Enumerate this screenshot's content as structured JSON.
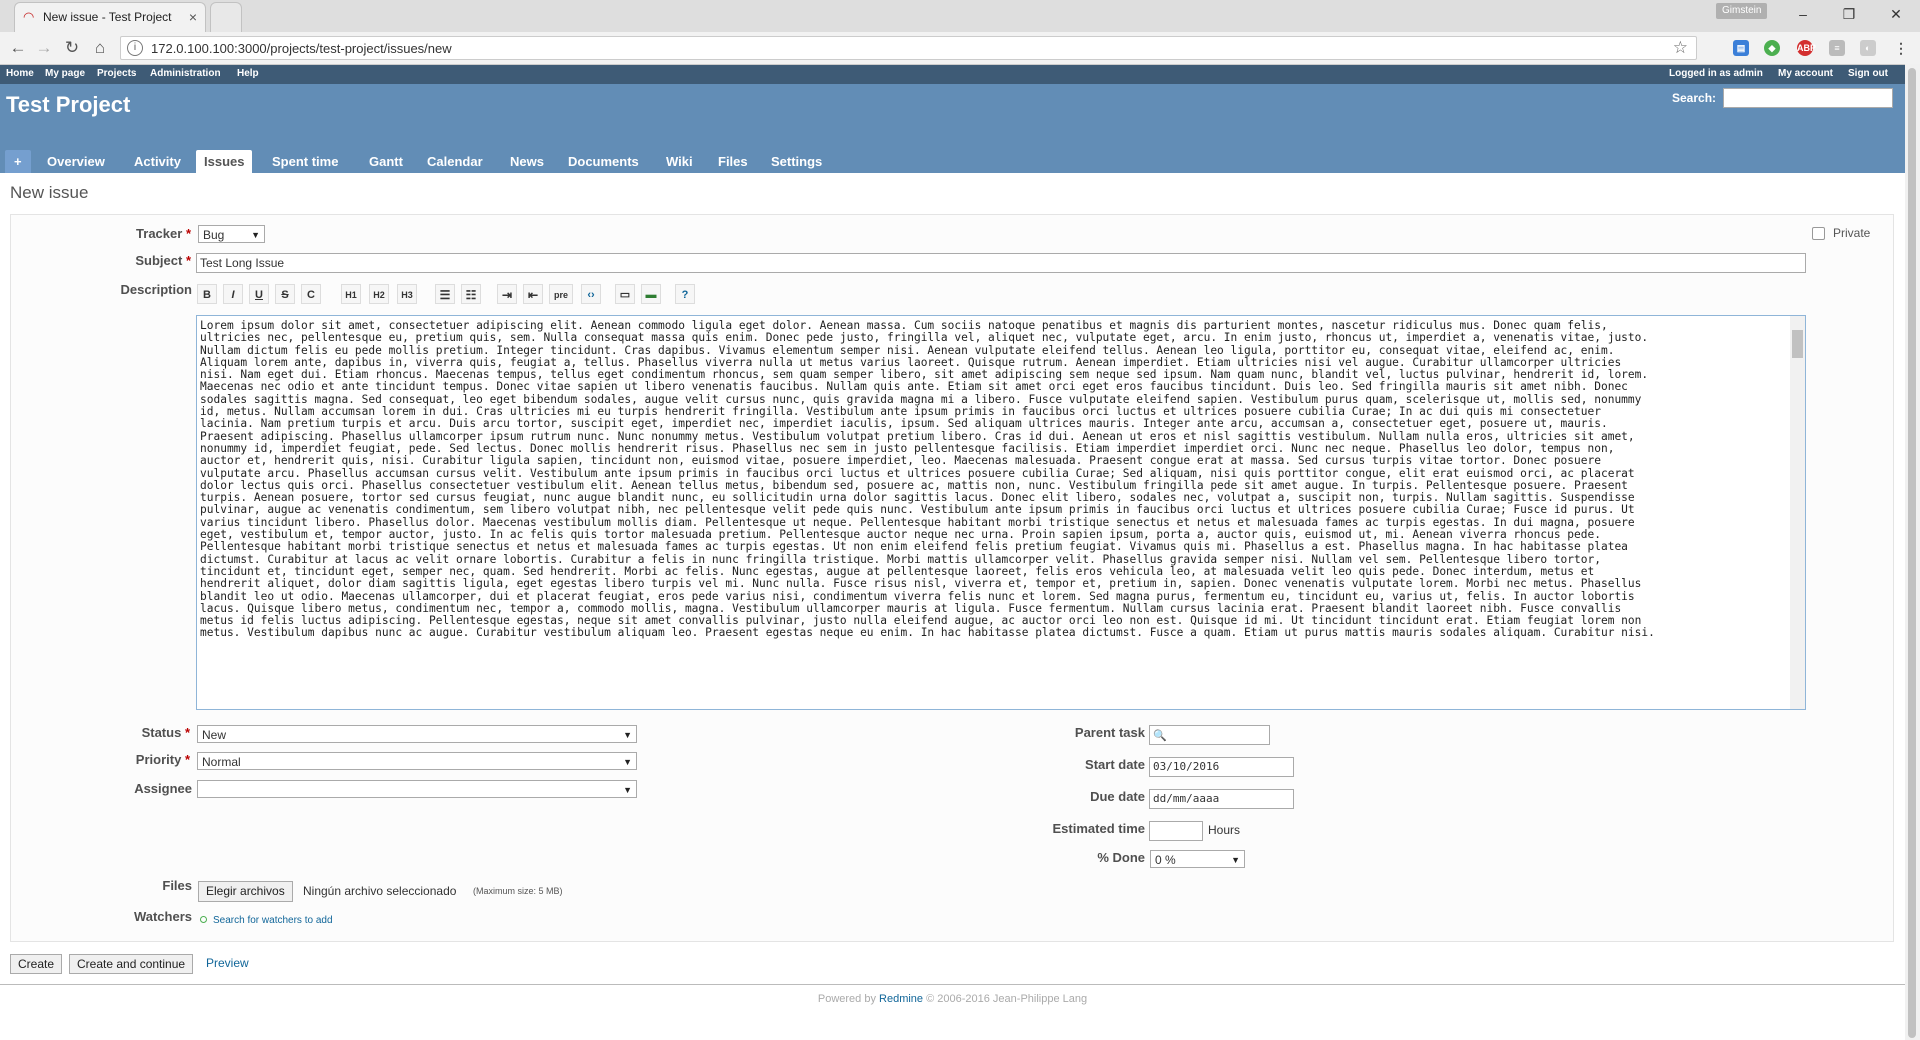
{
  "browser": {
    "tab_title": "New issue - Test Project",
    "user_chip": "Gimstein",
    "url": "172.0.100.100:3000/projects/test-project/issues/new"
  },
  "top_menu": {
    "left": [
      "Home",
      "My page",
      "Projects",
      "Administration",
      "Help"
    ],
    "logged_in_prefix": "Logged in as",
    "logged_in_user": "admin",
    "right": [
      "My account",
      "Sign out"
    ]
  },
  "header": {
    "project_title": "Test Project",
    "search_label": "Search:"
  },
  "main_menu": {
    "plus": "+",
    "tabs": [
      "Overview",
      "Activity",
      "Issues",
      "Spent time",
      "Gantt",
      "Calendar",
      "News",
      "Documents",
      "Wiki",
      "Files",
      "Settings"
    ],
    "selected": "Issues"
  },
  "page_title": "New issue",
  "form": {
    "tracker_label": "Tracker",
    "tracker_value": "Bug",
    "private_label": "Private",
    "subject_label": "Subject",
    "subject_value": "Test Long Issue",
    "description_label": "Description",
    "toolbar": [
      "B",
      "I",
      "U",
      "S",
      "C",
      "H1",
      "H2",
      "H3",
      "ul",
      "ol",
      "indent",
      "outdent",
      "pre",
      "code",
      "link",
      "image",
      "help"
    ],
    "description_lines": [
      "Lorem ipsum dolor sit amet, consectetuer adipiscing elit. Aenean commodo ligula eget dolor. Aenean massa. Cum sociis natoque penatibus et magnis dis parturient montes, nascetur ridiculus mus. Donec quam felis,",
      "ultricies nec, pellentesque eu, pretium quis, sem. Nulla consequat massa quis enim. Donec pede justo, fringilla vel, aliquet nec, vulputate eget, arcu. In enim justo, rhoncus ut, imperdiet a, venenatis vitae, justo.",
      "Nullam dictum felis eu pede mollis pretium. Integer tincidunt. Cras dapibus. Vivamus elementum semper nisi. Aenean vulputate eleifend tellus. Aenean leo ligula, porttitor eu, consequat vitae, eleifend ac, enim.",
      "Aliquam lorem ante, dapibus in, viverra quis, feugiat a, tellus. Phasellus viverra nulla ut metus varius laoreet. Quisque rutrum. Aenean imperdiet. Etiam ultricies nisi vel augue. Curabitur ullamcorper ultricies",
      "nisi. Nam eget dui. Etiam rhoncus. Maecenas tempus, tellus eget condimentum rhoncus, sem quam semper libero, sit amet adipiscing sem neque sed ipsum. Nam quam nunc, blandit vel, luctus pulvinar, hendrerit id, lorem.",
      "Maecenas nec odio et ante tincidunt tempus. Donec vitae sapien ut libero venenatis faucibus. Nullam quis ante. Etiam sit amet orci eget eros faucibus tincidunt. Duis leo. Sed fringilla mauris sit amet nibh. Donec",
      "sodales sagittis magna. Sed consequat, leo eget bibendum sodales, augue velit cursus nunc, quis gravida magna mi a libero. Fusce vulputate eleifend sapien. Vestibulum purus quam, scelerisque ut, mollis sed, nonummy",
      "id, metus. Nullam accumsan lorem in dui. Cras ultricies mi eu turpis hendrerit fringilla. Vestibulum ante ipsum primis in faucibus orci luctus et ultrices posuere cubilia Curae; In ac dui quis mi consectetuer",
      "lacinia. Nam pretium turpis et arcu. Duis arcu tortor, suscipit eget, imperdiet nec, imperdiet iaculis, ipsum. Sed aliquam ultrices mauris. Integer ante arcu, accumsan a, consectetuer eget, posuere ut, mauris.",
      "Praesent adipiscing. Phasellus ullamcorper ipsum rutrum nunc. Nunc nonummy metus. Vestibulum volutpat pretium libero. Cras id dui. Aenean ut eros et nisl sagittis vestibulum. Nullam nulla eros, ultricies sit amet,",
      "nonummy id, imperdiet feugiat, pede. Sed lectus. Donec mollis hendrerit risus. Phasellus nec sem in justo pellentesque facilisis. Etiam imperdiet imperdiet orci. Nunc nec neque. Phasellus leo dolor, tempus non,",
      "auctor et, hendrerit quis, nisi. Curabitur ligula sapien, tincidunt non, euismod vitae, posuere imperdiet, leo. Maecenas malesuada. Praesent congue erat at massa. Sed cursus turpis vitae tortor. Donec posuere",
      "vulputate arcu. Phasellus accumsan cursus velit. Vestibulum ante ipsum primis in faucibus orci luctus et ultrices posuere cubilia Curae; Sed aliquam, nisi quis porttitor congue, elit erat euismod orci, ac placerat",
      "dolor lectus quis orci. Phasellus consectetuer vestibulum elit. Aenean tellus metus, bibendum sed, posuere ac, mattis non, nunc. Vestibulum fringilla pede sit amet augue. In turpis. Pellentesque posuere. Praesent",
      "turpis. Aenean posuere, tortor sed cursus feugiat, nunc augue blandit nunc, eu sollicitudin urna dolor sagittis lacus. Donec elit libero, sodales nec, volutpat a, suscipit non, turpis. Nullam sagittis. Suspendisse",
      "pulvinar, augue ac venenatis condimentum, sem libero volutpat nibh, nec pellentesque velit pede quis nunc. Vestibulum ante ipsum primis in faucibus orci luctus et ultrices posuere cubilia Curae; Fusce id purus. Ut",
      "varius tincidunt libero. Phasellus dolor. Maecenas vestibulum mollis diam. Pellentesque ut neque. Pellentesque habitant morbi tristique senectus et netus et malesuada fames ac turpis egestas. In dui magna, posuere",
      "eget, vestibulum et, tempor auctor, justo. In ac felis quis tortor malesuada pretium. Pellentesque auctor neque nec urna. Proin sapien ipsum, porta a, auctor quis, euismod ut, mi. Aenean viverra rhoncus pede.",
      "Pellentesque habitant morbi tristique senectus et netus et malesuada fames ac turpis egestas. Ut non enim eleifend felis pretium feugiat. Vivamus quis mi. Phasellus a est. Phasellus magna. In hac habitasse platea",
      "dictumst. Curabitur at lacus ac velit ornare lobortis. Curabitur a felis in nunc fringilla tristique. Morbi mattis ullamcorper velit. Phasellus gravida semper nisi. Nullam vel sem. Pellentesque libero tortor,",
      "tincidunt et, tincidunt eget, semper nec, quam. Sed hendrerit. Morbi ac felis. Nunc egestas, augue at pellentesque laoreet, felis eros vehicula leo, at malesuada velit leo quis pede. Donec interdum, metus et",
      "hendrerit aliquet, dolor diam sagittis ligula, eget egestas libero turpis vel mi. Nunc nulla. Fusce risus nisl, viverra et, tempor et, pretium in, sapien. Donec venenatis vulputate lorem. Morbi nec metus. Phasellus",
      "blandit leo ut odio. Maecenas ullamcorper, dui et placerat feugiat, eros pede varius nisi, condimentum viverra felis nunc et lorem. Sed magna purus, fermentum eu, tincidunt eu, varius ut, felis. In auctor lobortis",
      "lacus. Quisque libero metus, condimentum nec, tempor a, commodo mollis, magna. Vestibulum ullamcorper mauris at ligula. Fusce fermentum. Nullam cursus lacinia erat. Praesent blandit laoreet nibh. Fusce convallis",
      "metus id felis luctus adipiscing. Pellentesque egestas, neque sit amet convallis pulvinar, justo nulla eleifend augue, ac auctor orci leo non est. Quisque id mi. Ut tincidunt tincidunt erat. Etiam feugiat lorem non",
      "metus. Vestibulum dapibus nunc ac augue. Curabitur vestibulum aliquam leo. Praesent egestas neque eu enim. In hac habitasse platea dictumst. Fusce a quam. Etiam ut purus mattis mauris sodales aliquam. Curabitur nisi."
    ],
    "status_label": "Status",
    "status_value": "New",
    "priority_label": "Priority",
    "priority_value": "Normal",
    "assignee_label": "Assignee",
    "assignee_value": "",
    "parent_task_label": "Parent task",
    "start_date_label": "Start date",
    "start_date_value": "03/10/2016",
    "due_date_label": "Due date",
    "due_date_value": "dd/mm/aaaa",
    "estimated_time_label": "Estimated time",
    "hours_label": "Hours",
    "done_label": "% Done",
    "done_value": "0 %",
    "files_label": "Files",
    "choose_files_button": "Elegir archivos",
    "no_file_text": "Ningún archivo seleccionado",
    "max_size_text": "(Maximum size: 5 MB)",
    "watchers_label": "Watchers",
    "watchers_link": "Search for watchers to add"
  },
  "actions": {
    "create": "Create",
    "create_continue": "Create and continue",
    "preview": "Preview"
  },
  "footer": {
    "powered_by": "Powered by",
    "redmine": "Redmine",
    "copyright": "© 2006-2016 Jean-Philippe Lang"
  }
}
